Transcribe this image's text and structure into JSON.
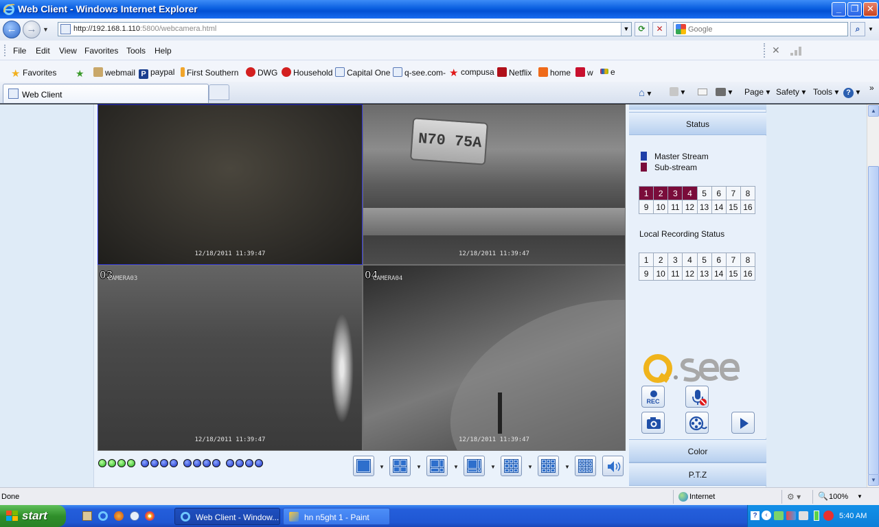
{
  "window": {
    "title": "Web Client - Windows Internet Explorer",
    "minimize": "_",
    "maximize": "❐",
    "close": "✕"
  },
  "address": {
    "url_host": "http://192.168.1.110",
    "url_port": ":5800",
    "url_path": "/webcamera.html",
    "search_placeholder": "Google"
  },
  "menu": [
    "File",
    "Edit",
    "View",
    "Favorites",
    "Tools",
    "Help"
  ],
  "favorites": {
    "label": "Favorites",
    "items": [
      "webmail",
      "paypal",
      "First Southern",
      "DWG",
      "Household",
      "Capital One",
      "q-see.com-",
      "compusa",
      "Netflix",
      "home",
      "w",
      "e"
    ]
  },
  "tabs": {
    "active_label": "Web Client",
    "commands": [
      "Page",
      "Safety",
      "Tools"
    ]
  },
  "viewer": {
    "cameras": [
      {
        "num": "",
        "name": "",
        "timestamp": "12/18/2011 11:39:47"
      },
      {
        "num": "",
        "name": "",
        "timestamp": "12/18/2011 11:39:47"
      },
      {
        "num": "03",
        "name": "CAMERA03",
        "timestamp": "12/18/2011 11:39:47"
      },
      {
        "num": "04",
        "name": "CAMERA04",
        "timestamp": "12/18/2011 11:39:47"
      }
    ],
    "license_plate": "N70 75A",
    "channel_dots": [
      "green",
      "green",
      "green",
      "green",
      "blue",
      "blue",
      "blue",
      "blue",
      "blue",
      "blue",
      "blue",
      "blue",
      "blue",
      "blue",
      "blue",
      "blue"
    ]
  },
  "panel": {
    "status_header": "Status",
    "master_stream": "Master Stream",
    "sub_stream": "Sub-stream",
    "master_color": "#1f3fa8",
    "sub_color": "#7a0c3a",
    "channels_row1": [
      "1",
      "2",
      "3",
      "4",
      "5",
      "6",
      "7",
      "8"
    ],
    "channels_row2": [
      "9",
      "10",
      "11",
      "12",
      "13",
      "14",
      "15",
      "16"
    ],
    "active_channels": [
      "1",
      "2",
      "3",
      "4"
    ],
    "local_recording_title": "Local Recording Status",
    "rec_label": "REC",
    "color_header": "Color",
    "ptz_header": "P.T.Z"
  },
  "statusbar": {
    "left": "Done",
    "zone": "Internet",
    "zoom": "100%"
  },
  "taskbar": {
    "start": "start",
    "tasks": [
      "Web Client - Window...",
      "hn n5ght 1 - Paint"
    ],
    "clock": "5:40 AM"
  }
}
